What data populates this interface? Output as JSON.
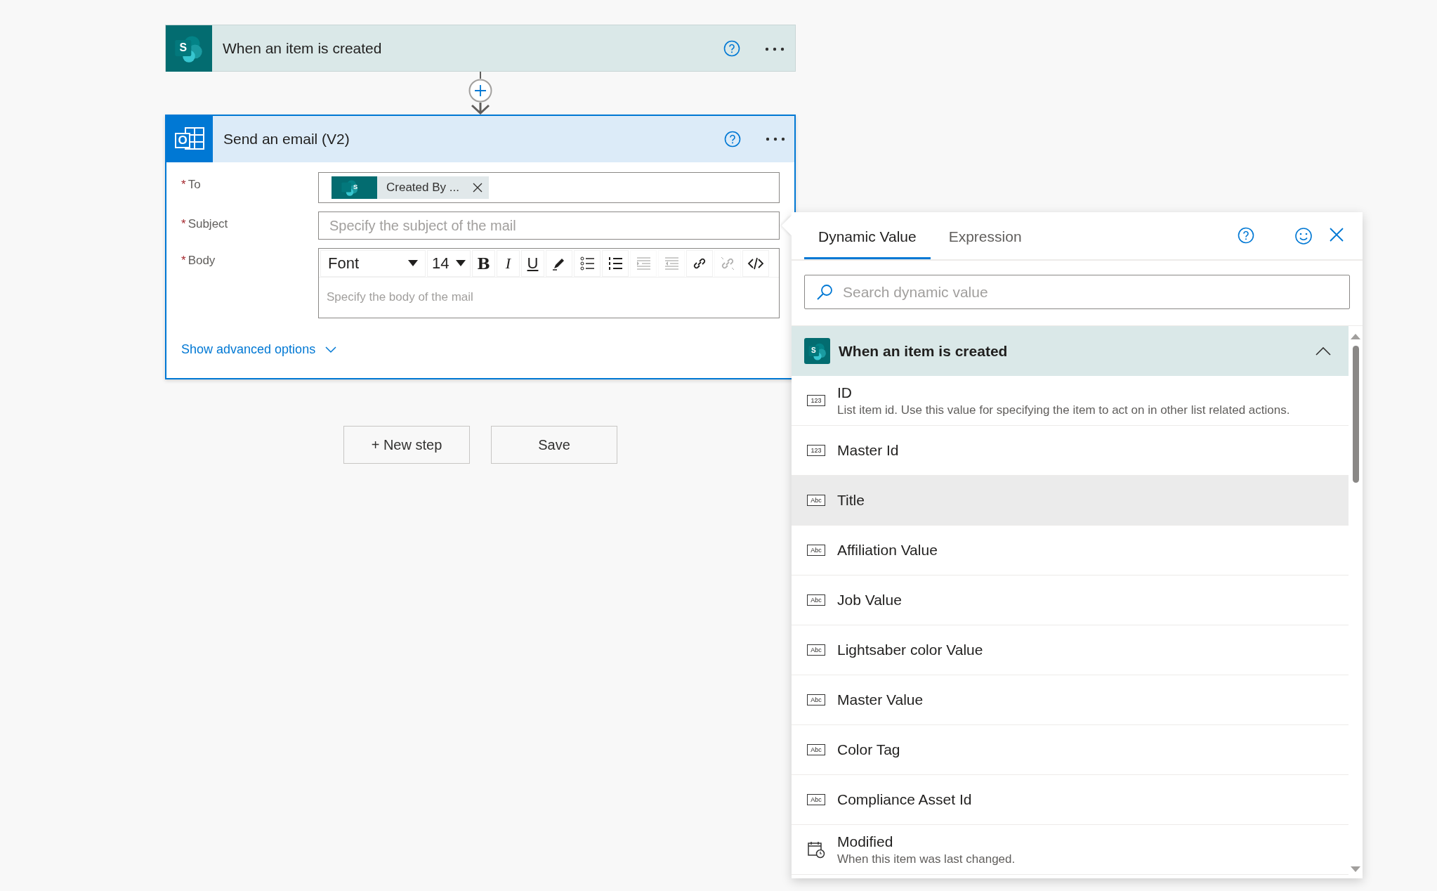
{
  "trigger": {
    "title": "When an item is created",
    "icon_letter": "S"
  },
  "action": {
    "title": "Send an email (V2)",
    "icon_letter": "O",
    "fields": [
      {
        "kind": "tokens",
        "label": "To",
        "required_mark": "*",
        "tokens": [
          {
            "label": "Created By ...",
            "icon_letter": "S"
          }
        ]
      },
      {
        "kind": "text",
        "label": "Subject",
        "required_mark": "*",
        "placeholder": "Specify the subject of the mail"
      },
      {
        "kind": "rich",
        "label": "Body",
        "required_mark": "*",
        "font": "Font",
        "size": "14",
        "placeholder": "Specify the body of the mail",
        "tools": [
          {
            "kind": "bold",
            "glyph": "B",
            "disabled": false
          },
          {
            "kind": "italic",
            "glyph": "I",
            "disabled": false
          },
          {
            "kind": "underline",
            "glyph": "U",
            "disabled": false
          },
          {
            "kind": "highlight",
            "disabled": false
          },
          {
            "kind": "bullets",
            "disabled": false
          },
          {
            "kind": "numbers",
            "disabled": false
          },
          {
            "kind": "indent",
            "disabled": true
          },
          {
            "kind": "outdent",
            "disabled": true
          },
          {
            "kind": "link",
            "disabled": false
          },
          {
            "kind": "unlink",
            "disabled": true
          },
          {
            "kind": "code",
            "disabled": false
          }
        ]
      }
    ],
    "advanced": "Show advanced options"
  },
  "buttons": [
    "+ New step",
    "Save"
  ],
  "panel": {
    "tabs": [
      {
        "label": "Dynamic Value",
        "selected": true
      },
      {
        "label": "Expression",
        "selected": false
      }
    ],
    "search": {
      "placeholder": "Search dynamic value"
    },
    "section": {
      "title": "When an item is created",
      "icon_letter": "S",
      "expanded": true
    },
    "items": [
      {
        "kind": "number",
        "badge": "123",
        "name": "ID",
        "description": "List item id. Use this value for specifying the item to act on in other list related actions.",
        "selected": false
      },
      {
        "kind": "number",
        "badge": "123",
        "name": "Master Id",
        "selected": false
      },
      {
        "kind": "text",
        "badge": "Abc",
        "name": "Title",
        "selected": true
      },
      {
        "kind": "text",
        "badge": "Abc",
        "name": "Affiliation Value",
        "selected": false
      },
      {
        "kind": "text",
        "badge": "Abc",
        "name": "Job Value",
        "selected": false
      },
      {
        "kind": "text",
        "badge": "Abc",
        "name": "Lightsaber color Value",
        "selected": false
      },
      {
        "kind": "text",
        "badge": "Abc",
        "name": "Master Value",
        "selected": false
      },
      {
        "kind": "text",
        "badge": "Abc",
        "name": "Color Tag",
        "selected": false
      },
      {
        "kind": "text",
        "badge": "Abc",
        "name": "Compliance Asset Id",
        "selected": false
      },
      {
        "kind": "date",
        "name": "Modified",
        "description": "When this item was last changed.",
        "selected": false
      }
    ]
  }
}
